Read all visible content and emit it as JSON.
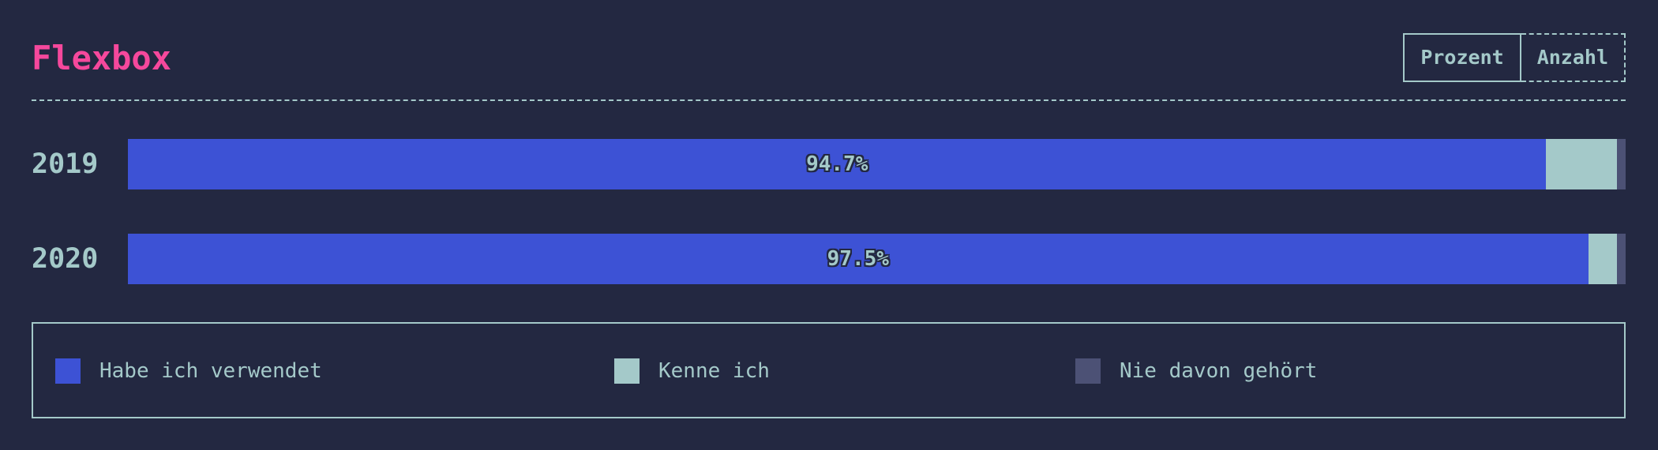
{
  "title": "Flexbox",
  "toggle": {
    "percent_label": "Prozent",
    "count_label": "Anzahl"
  },
  "colors": {
    "background": "#232841",
    "title": "#f5489c",
    "text": "#a4c9c9",
    "used": "#3d52d5",
    "know": "#a4c9c9",
    "never_heard": "#4c5175"
  },
  "chart_data": {
    "type": "bar",
    "stacked": true,
    "orientation": "horizontal",
    "categories": [
      "2019",
      "2020"
    ],
    "series": [
      {
        "name": "Habe ich verwendet",
        "values": [
          94.7,
          97.5
        ]
      },
      {
        "name": "Kenne ich",
        "values": [
          4.7,
          1.9
        ]
      },
      {
        "name": "Nie davon gehört",
        "values": [
          0.6,
          0.6
        ]
      }
    ],
    "data_labels": [
      "94.7%",
      "97.5%"
    ],
    "xlim": [
      0,
      100
    ],
    "unit": "%",
    "legend_position": "bottom"
  }
}
